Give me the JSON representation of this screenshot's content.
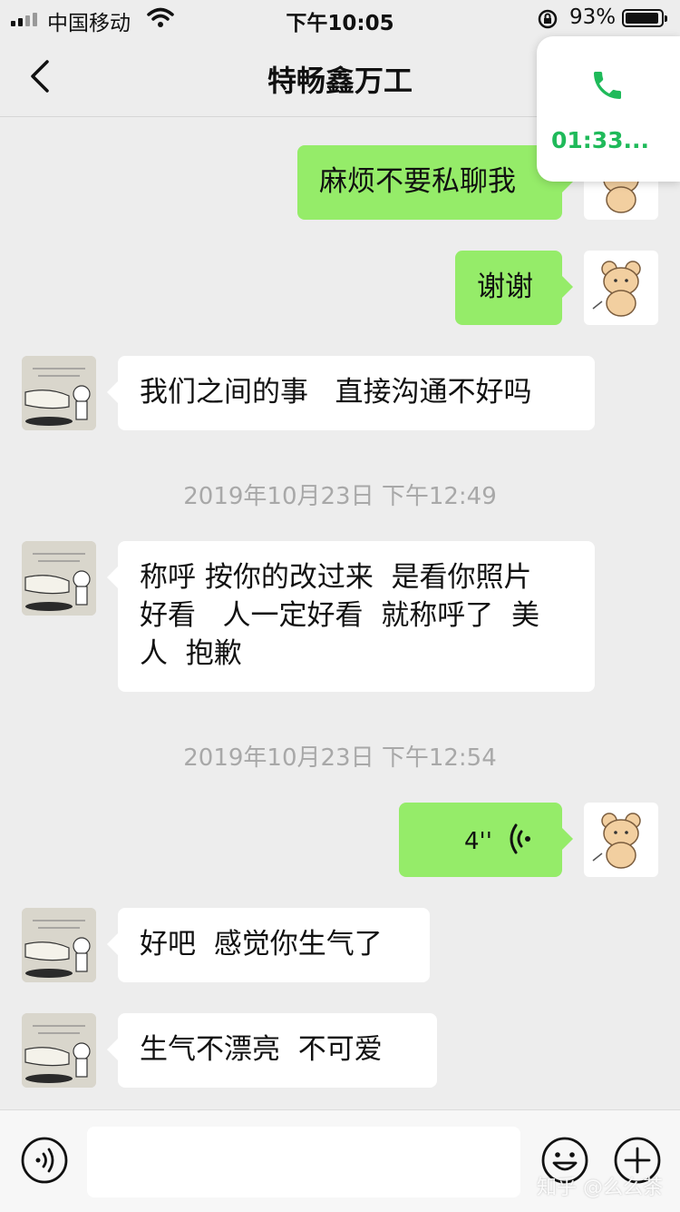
{
  "status_bar": {
    "carrier": "中国移动",
    "time": "下午10:05",
    "battery": "93%"
  },
  "chat": {
    "title": "特畅鑫万工"
  },
  "call": {
    "timer": "01:33..."
  },
  "messages": [
    {
      "text": "麻烦不要私聊我"
    },
    {
      "text": "谢谢"
    },
    {
      "text": "我们之间的事   直接沟通不好吗"
    },
    {
      "timestamp": "2019年10月23日 下午12:49"
    },
    {
      "text": "称呼 按你的改过来  是看你照片\n好看   人一定好看  就称呼了  美\n人  抱歉"
    },
    {
      "timestamp": "2019年10月23日 下午12:54"
    },
    {
      "voice_length": "4''"
    },
    {
      "text": "好吧  感觉你生气了"
    },
    {
      "text": "生气不漂亮  不可爱"
    }
  ],
  "input": {
    "placeholder": ""
  },
  "watermark": "知乎 @么么茶",
  "colors": {
    "outgoing": "#95ec69",
    "incoming": "#ffffff",
    "background": "#ededed",
    "call_green": "#1fba5a"
  }
}
